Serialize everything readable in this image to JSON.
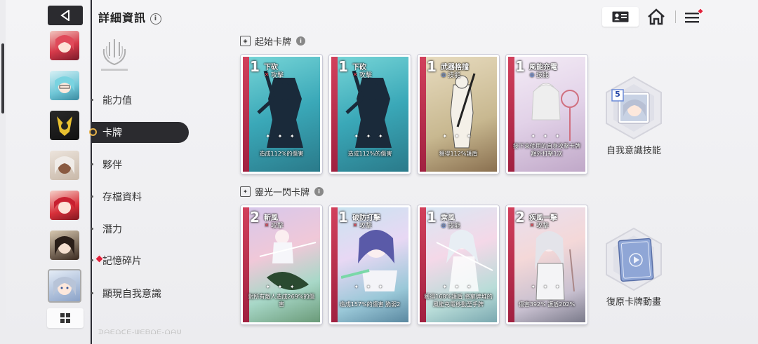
{
  "header": {
    "title": "詳細資訊",
    "info": "i"
  },
  "menu": [
    {
      "label": "能力值"
    },
    {
      "label": "卡牌"
    },
    {
      "label": "夥伴"
    },
    {
      "label": "存檔資料"
    },
    {
      "label": "潛力"
    },
    {
      "label": "記憶碎片"
    },
    {
      "label": "顯現自我意識"
    }
  ],
  "watermark": "ᗪᗩᗴᗝᑕᗴ-ᗯᗴᗷᗝᗴ-ᗝᗩᑌ",
  "sections": {
    "starting": {
      "title": "起始卡牌"
    },
    "flash": {
      "title": "靈光一閃卡牌"
    }
  },
  "starting_cards": [
    {
      "cost": "1",
      "name": "下砍",
      "type": "攻擊",
      "type_kind": "attack",
      "desc": "造成112%的傷害"
    },
    {
      "cost": "1",
      "name": "下砍",
      "type": "攻擊",
      "type_kind": "attack",
      "desc": "造成112%的傷害"
    },
    {
      "cost": "1",
      "name": "武器格擋",
      "type": "技能",
      "type_kind": "skill",
      "desc": "獲得112%護盾"
    },
    {
      "cost": "1",
      "name": "風能充電",
      "type": "技能",
      "type_kind": "skill",
      "desc": "接下來使用的自身攻擊卡牌額外打擊1次"
    }
  ],
  "flash_cards": [
    {
      "cost": "2",
      "name": "斬風",
      "type": "攻擊",
      "type_kind": "attack",
      "desc": "對所有敵人造成269%的傷害"
    },
    {
      "cost": "1",
      "name": "破防打擊",
      "type": "攻擊",
      "type_kind": "attack",
      "desc": "造成157%的傷害 脆弱2"
    },
    {
      "cost": "1",
      "name": "乘風",
      "type": "技能",
      "type_kind": "skill",
      "desc": "獲得168%護盾 將棄牌堆的風能充電移動至手牌"
    },
    {
      "cost": "2",
      "name": "疾風一擊",
      "type": "攻擊",
      "type_kind": "attack",
      "desc": "傷害392% 護盾202%"
    }
  ],
  "ego_skill": {
    "label": "自我意識技能",
    "cost": "5"
  },
  "restore": {
    "label": "復原卡牌動畫"
  },
  "colors": {
    "accent": "#2b2b2f",
    "attack": "#ff4a5a",
    "skill": "#6ea0ff",
    "badge": "#e0223c"
  },
  "icons": [
    "back-arrow-icon",
    "info-icon",
    "profile-card-icon",
    "home-icon",
    "hamburger-menu-icon",
    "grid-icon"
  ]
}
